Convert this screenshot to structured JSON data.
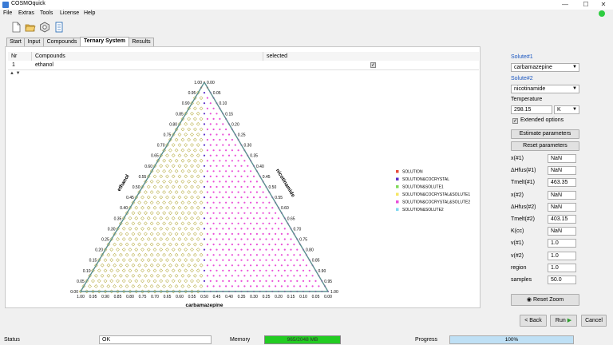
{
  "window": {
    "title": "COSMOquick",
    "minimize": "—",
    "maximize": "☐",
    "close": "✕"
  },
  "menu": [
    "File",
    "Extras",
    "Tools",
    "License",
    "Help"
  ],
  "toolbar_icons": [
    "new-file-icon",
    "open-folder-icon",
    "settings-hex-icon",
    "document-icon"
  ],
  "tabs": [
    "Start",
    "Input",
    "Compounds",
    "Ternary System",
    "Results"
  ],
  "active_tab": "Ternary System",
  "grid": {
    "headers": [
      "Nr",
      "Compounds",
      "selected"
    ],
    "rows": [
      {
        "nr": "1",
        "compound": "ethanol",
        "selected": "✓"
      }
    ]
  },
  "plot": {
    "bottom_label": "carbamazepine",
    "left_label": "ethanol",
    "right_label": "nicotinamide",
    "ticks": [
      "1.00",
      "0.95",
      "0.90",
      "0.85",
      "0.80",
      "0.75",
      "0.70",
      "0.65",
      "0.60",
      "0.55",
      "0.50",
      "0.45",
      "0.40",
      "0.35",
      "0.30",
      "0.25",
      "0.20",
      "0.15",
      "0.10",
      "0.05",
      "0.00"
    ],
    "legend": [
      {
        "label": "SOLUTION",
        "color": "#e74c3c"
      },
      {
        "label": "SOLUTION&COCRYSTAL",
        "color": "#5b2fc9"
      },
      {
        "label": "SOLUTION&SOLUTE1",
        "color": "#7ed957"
      },
      {
        "label": "SOLUTION&COCRYSTAL&SOLUTE1",
        "color": "#f5e663"
      },
      {
        "label": "SOLUTION&COCRYSTAL&SOLUTE2",
        "color": "#e94fd8"
      },
      {
        "label": "SOLUTION&SOLUTE2",
        "color": "#7fd8f0"
      }
    ]
  },
  "side": {
    "solute1_label": "Solute#1",
    "solute1_value": "carbamazepine",
    "solute2_label": "Solute#2",
    "solute2_value": "nicotinamide",
    "temperature_label": "Temperature",
    "temperature_value": "298.15",
    "temperature_unit": "K",
    "extended_label": "Extended options",
    "estimate_button": "Estimate parameters",
    "reset_params_button": "Reset parameters",
    "params": [
      {
        "label": "x(#1)",
        "value": "NaN"
      },
      {
        "label": "ΔHfus(#1)",
        "value": "NaN"
      },
      {
        "label": "Tmelt(#1)",
        "value": "463.35"
      },
      {
        "label": "x(#2)",
        "value": "NaN"
      },
      {
        "label": "ΔHfus(#2)",
        "value": "NaN"
      },
      {
        "label": "Tmelt(#2)",
        "value": "403.15"
      },
      {
        "label": "K(cc)",
        "value": "NaN"
      },
      {
        "label": "v(#1)",
        "value": "1.0"
      },
      {
        "label": "v(#2)",
        "value": "1.0"
      },
      {
        "label": "region",
        "value": "1.0"
      },
      {
        "label": "samples",
        "value": "50.0"
      }
    ],
    "reset_zoom_button": "Reset Zoom"
  },
  "nav": {
    "back": "< Back",
    "run": "Run",
    "cancel": "Cancel"
  },
  "footer": {
    "status_label": "Status",
    "status_value": "OK",
    "memory_label": "Memory",
    "memory_value": "965/2048 MB",
    "progress_label": "Progress",
    "progress_value": "100%",
    "progress_fraction": 1.0
  }
}
